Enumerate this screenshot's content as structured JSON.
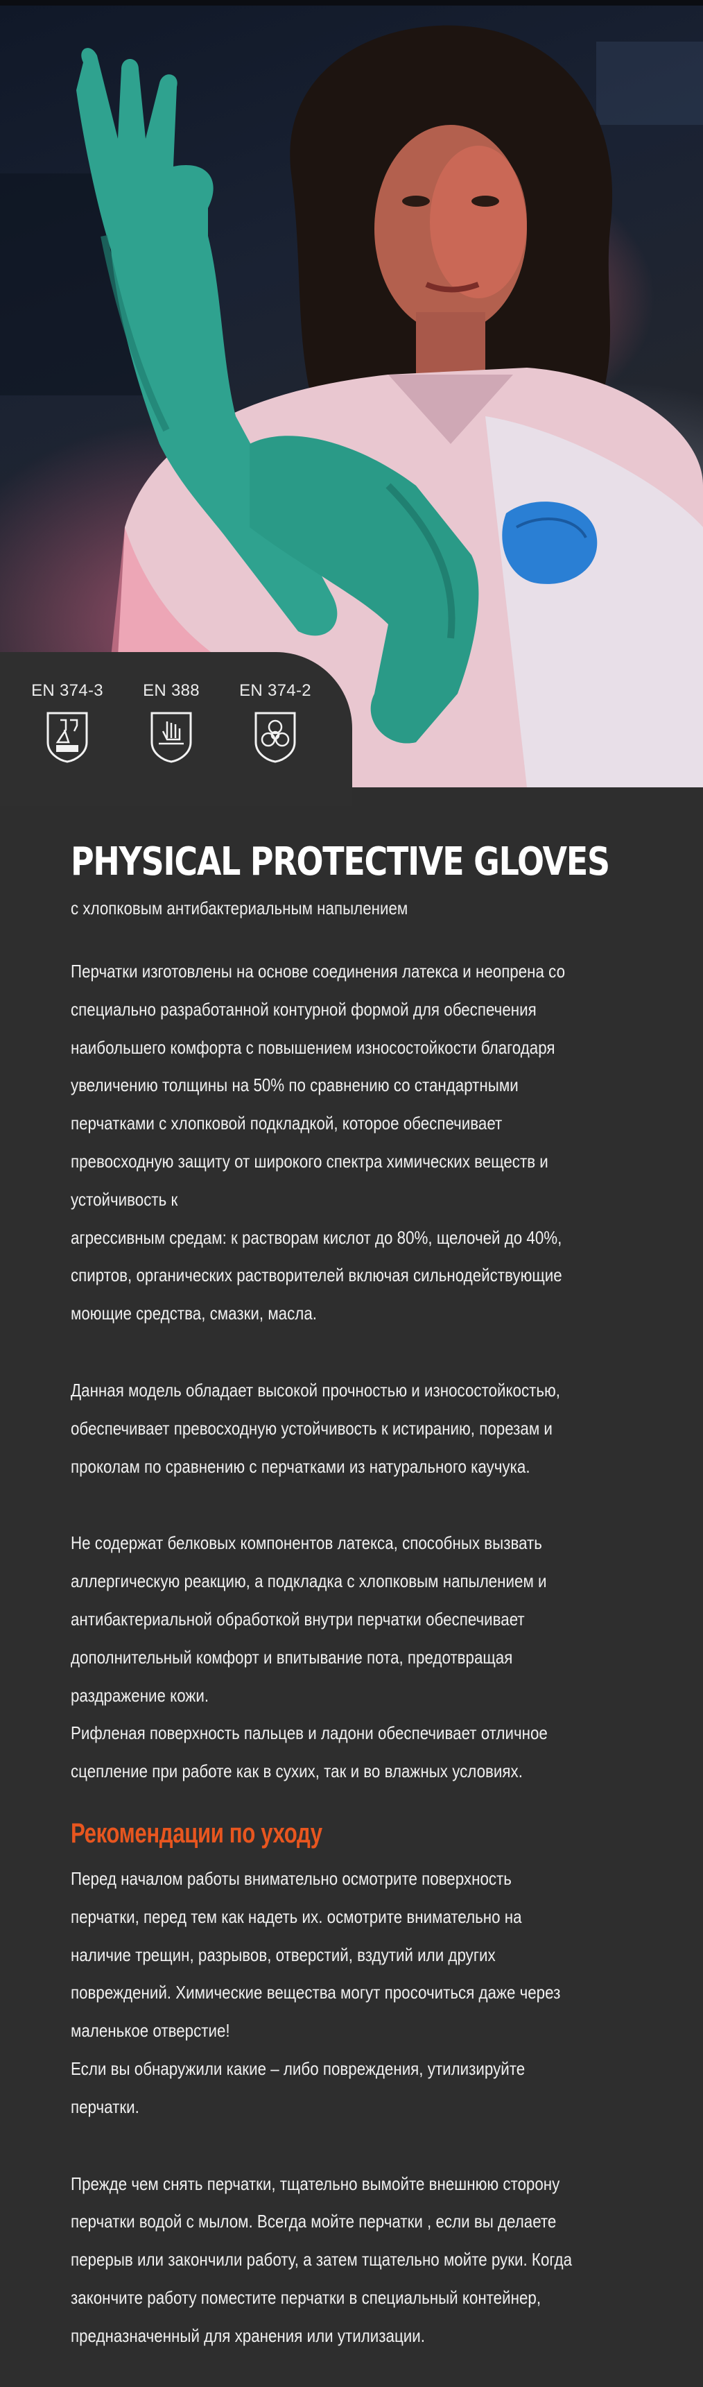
{
  "standards": [
    {
      "label": "EN 374-3",
      "icon": "chemical-flask-icon"
    },
    {
      "label": "EN 388",
      "icon": "mechanical-hand-icon"
    },
    {
      "label": "EN 374-2",
      "icon": "biohazard-icon"
    }
  ],
  "product": {
    "title": "PHYSICAL PROTECTIVE GLOVES",
    "subtitle": "с хлопковым антибактериальным напылением"
  },
  "description": {
    "p1": [
      "Перчатки изготовлены на основе соединения латекса и неопрена со",
      "специально разработанной контурной формой  для обеспечения",
      "наибольшего комфорта с повышением износостойкости благодаря",
      "увеличению толщины на 50%  по сравнению со стандартными",
      "перчатками с хлопковой подкладкой, которое обеспечивает",
      "превосходную защиту от широкого спектра химических веществ и",
      "устойчивость к",
      "агрессивным средам: к растворам кислот до 80%, щелочей до 40%,",
      "спиртов, органических растворителей включая  сильнодействующие",
      "моющие средства, смазки, масла."
    ],
    "p2": [
      "Данная модель обладает высокой прочностью и износостойкостью,",
      "обеспечивает превосходную устойчивость к  истиранию, порезам и",
      "проколам по сравнению с перчатками из натурального каучука."
    ],
    "p3": [
      "Не содержат белковых компонентов латекса, способных вызвать",
      "аллергическую реакцию, а подкладка с хлопковым  напылением и",
      "антибактериальной обработкой внутри перчатки обеспечивает",
      "дополнительный комфорт и впитывание пота, предотвращая",
      "раздражение кожи.",
      "  Рифленая поверхность пальцев и ладони обеспечивает отличное",
      "сцепление при работе как в сухих,  так и во  влажных условиях."
    ]
  },
  "care": {
    "title": "Рекомендации по уходу",
    "p1": [
      "Перед началом работы внимательно осмотрите поверхность",
      "перчатки, перед тем как надеть их. осмотрите  внимательно на",
      "наличие трещин, разрывов, отверстий, вздутий или других",
      "повреждений. Химические вещества могут просочиться даже через",
      "маленькое отверстие!",
      "  Если вы обнаружили какие – либо повреждения, утилизируйте",
      "перчатки."
    ],
    "p2": [
      "Прежде чем снять перчатки, тщательно вымойте внешнюю сторону",
      "перчатки водой с мылом.  Всегда мойте перчатки , если вы делаете",
      "перерыв или закончили работу, а затем тщательно мойте руки. Когда",
      "закончите работу поместите  перчатки в специальный контейнер,",
      "предназначенный для хранения или утилизации."
    ]
  },
  "colors": {
    "background": "#2e2e2e",
    "accent": "#e8561f",
    "glove": "#2fa28f",
    "text": "#f0f0f0"
  }
}
